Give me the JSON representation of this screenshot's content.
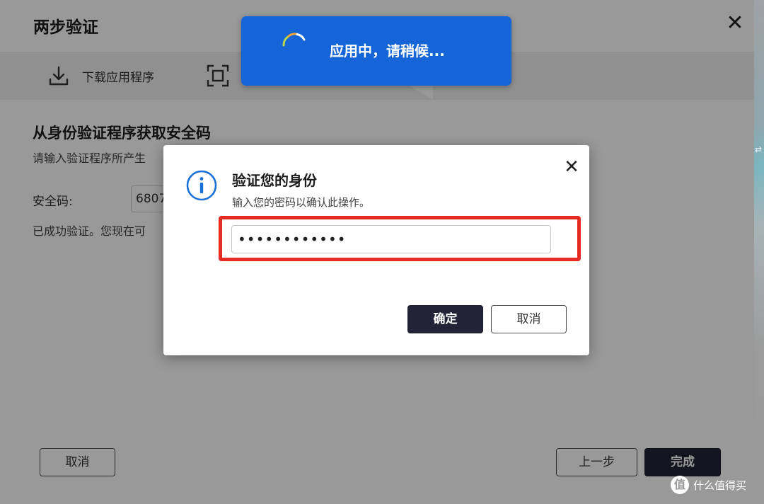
{
  "wizard": {
    "title": "两步验证",
    "close_glyph": "✕",
    "steps": [
      {
        "label": "下载应用程序",
        "icon": "download-icon"
      },
      {
        "label": "",
        "icon": "scan-icon"
      }
    ],
    "section_title": "从身份验证程序获取安全码",
    "section_desc": "请输入验证程序所产生",
    "code_label": "安全码:",
    "code_value": "6807",
    "success_text": "已成功验证。您现在可",
    "buttons": {
      "cancel": "取消",
      "prev": "上一步",
      "done": "完成"
    }
  },
  "toast": {
    "text": "应用中，请稍候...",
    "color": "#1565d8",
    "icon": "spinner-icon"
  },
  "dialog": {
    "title": "验证您的身份",
    "subtitle": "输入您的密码以确认此操作。",
    "close_glyph": "✕",
    "icon": "info-icon",
    "password_value": "••••••••••••",
    "buttons": {
      "ok": "确定",
      "cancel": "取消"
    },
    "highlight_color": "#e62b23"
  },
  "watermark": {
    "logo_text": "值",
    "text": "什么值得买"
  },
  "desktop_glyph": "⇄"
}
